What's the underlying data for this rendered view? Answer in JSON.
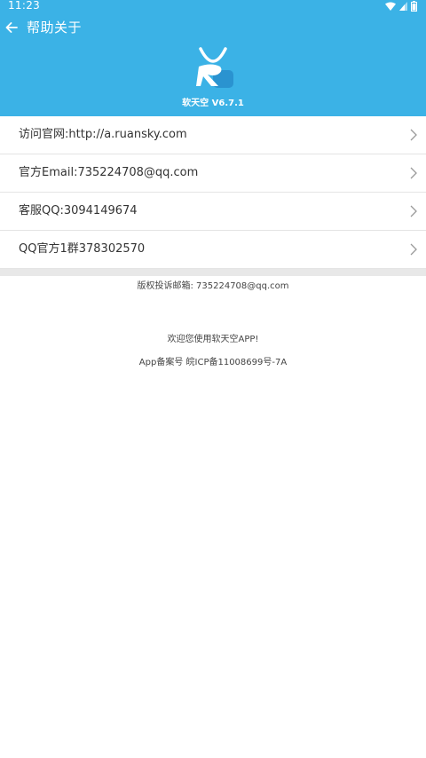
{
  "status_bar": {
    "time": "11:23",
    "icons": [
      "wifi-icon",
      "signal-icon",
      "battery-icon"
    ]
  },
  "toolbar": {
    "back_icon": "arrow-left-icon",
    "title": "帮助关于"
  },
  "app": {
    "version_text": "软天空 V6.7.1"
  },
  "menu": {
    "items": [
      {
        "label": "访问官网:http://a.ruansky.com"
      },
      {
        "label": "官方Email:735224708@qq.com"
      },
      {
        "label": "客服QQ:3094149674"
      },
      {
        "label": "QQ官方1群378302570"
      }
    ]
  },
  "footer": {
    "copyright": "版权投诉邮箱:  735224708@qq.com",
    "welcome": "欢迎您使用软天空APP!",
    "icp": "App备案号  皖ICP备11008699号-7A"
  },
  "colors": {
    "header_bg": "#3bb2e6",
    "divider": "#e8e8e8",
    "text": "#333333"
  }
}
